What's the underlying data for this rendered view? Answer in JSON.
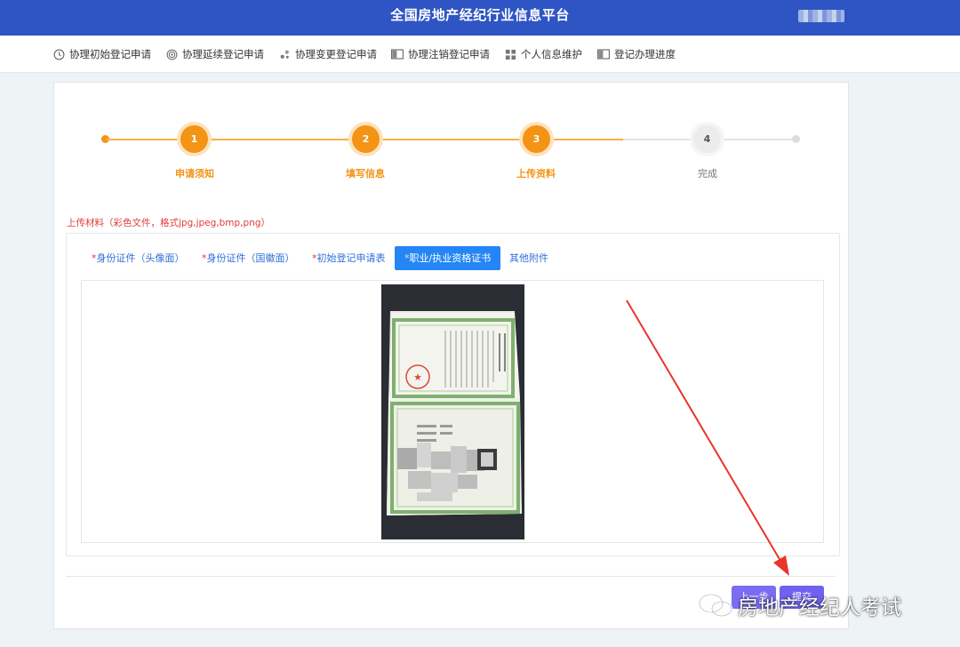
{
  "header": {
    "title": "全国房地产经纪行业信息平台",
    "brand_color": "#2f55c4"
  },
  "nav": {
    "items": [
      {
        "label": "协理初始登记申请",
        "icon": "clock-icon"
      },
      {
        "label": "协理延续登记申请",
        "icon": "target-icon"
      },
      {
        "label": "协理变更登记申请",
        "icon": "dots-icon"
      },
      {
        "label": "协理注销登记申请",
        "icon": "book-icon"
      },
      {
        "label": "个人信息维护",
        "icon": "grid-icon"
      },
      {
        "label": "登记办理进度",
        "icon": "book-icon"
      }
    ]
  },
  "steps": {
    "current": 3,
    "accent_color": "#f39415",
    "items": [
      {
        "number": "1",
        "label": "申请须知",
        "state": "active"
      },
      {
        "number": "2",
        "label": "填写信息",
        "state": "active"
      },
      {
        "number": "3",
        "label": "上传资料",
        "state": "active"
      },
      {
        "number": "4",
        "label": "完成",
        "state": "todo"
      }
    ]
  },
  "upload": {
    "hint": "上传材料（彩色文件，格式jpg,jpeg,bmp,png）",
    "required_mark": "*",
    "tabs": [
      {
        "label": "身份证件（头像面）",
        "required": true,
        "active": false
      },
      {
        "label": "身份证件（国徽面）",
        "required": true,
        "active": false
      },
      {
        "label": "初始登记申请表",
        "required": true,
        "active": false
      },
      {
        "label": "职业/执业资格证书",
        "required": true,
        "active": true
      },
      {
        "label": "其他附件",
        "required": false,
        "active": false
      }
    ],
    "preview": "certificate-photo"
  },
  "actions": {
    "prev_label": "上一步",
    "submit_label": "提交"
  },
  "watermark": {
    "text": "房地产经纪人考试"
  },
  "annotation": {
    "color": "#e8352b"
  }
}
